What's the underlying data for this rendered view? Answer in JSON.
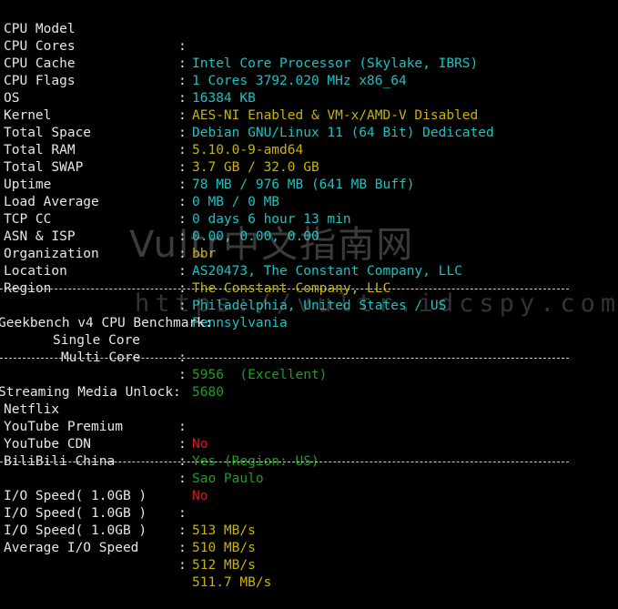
{
  "sep": ":",
  "divider": "",
  "system": [
    {
      "label": "CPU Model",
      "value": "Intel Core Processor (Skylake, IBRS)"
    },
    {
      "label": "CPU Cores",
      "value": "1 Cores 3792.020 MHz x86_64"
    },
    {
      "label": "CPU Cache",
      "value": "16384 KB"
    },
    {
      "label": "CPU Flags",
      "value": "AES-NI Enabled & VM-x/AMD-V Disabled"
    },
    {
      "label": "OS",
      "value": "Debian GNU/Linux 11 (64 Bit) Dedicated"
    },
    {
      "label": "Kernel",
      "value": "5.10.0-9-amd64"
    },
    {
      "label": "Total Space",
      "value": "3.7 GB / 32.0 GB"
    },
    {
      "label": "Total RAM",
      "value": "78 MB / 976 MB (641 MB Buff)"
    },
    {
      "label": "Total SWAP",
      "value": "0 MB / 0 MB"
    },
    {
      "label": "Uptime",
      "value": "0 days 6 hour 13 min"
    },
    {
      "label": "Load Average",
      "value": "0.00, 0.00, 0.00"
    },
    {
      "label": "TCP CC",
      "value": "bbr"
    },
    {
      "label": "ASN & ISP",
      "value": "AS20473, The Constant Company, LLC"
    },
    {
      "label": "Organization",
      "value": "The Constant Company, LLC"
    },
    {
      "label": "Location",
      "value": "Philadelphia, United States / US"
    },
    {
      "label": "Region",
      "value": "Pennsylvania"
    }
  ],
  "geekbench": {
    "title": "Geekbench v4 CPU Benchmark:",
    "single_label": "Single Core",
    "single_value": "5956  (Excellent)",
    "multi_label": "Multi Core",
    "multi_value": "5680"
  },
  "streaming": {
    "title": "Streaming Media Unlock:",
    "items": [
      {
        "label": "Netflix",
        "value": "No"
      },
      {
        "label": "YouTube Premium",
        "value": "Yes (Region: US)"
      },
      {
        "label": "YouTube CDN",
        "value": "Sao Paulo"
      },
      {
        "label": "BiliBili China",
        "value": "No"
      }
    ]
  },
  "io": [
    {
      "label": "I/O Speed( 1.0GB )",
      "value": "513 MB/s"
    },
    {
      "label": "I/O Speed( 1.0GB )",
      "value": "510 MB/s"
    },
    {
      "label": "I/O Speed( 1.0GB )",
      "value": "512 MB/s"
    },
    {
      "label": "Average I/O Speed",
      "value": "511.7 MB/s"
    }
  ],
  "watermark": {
    "line1": "Vultr中文指南网",
    "line2": "https://vultr.idcspy.com/"
  },
  "colors": {
    "cyan": "#19c3c3",
    "yellow": "#c8b400",
    "green": "#1f9e1f",
    "red": "#d21a1a",
    "background": "#000000"
  }
}
